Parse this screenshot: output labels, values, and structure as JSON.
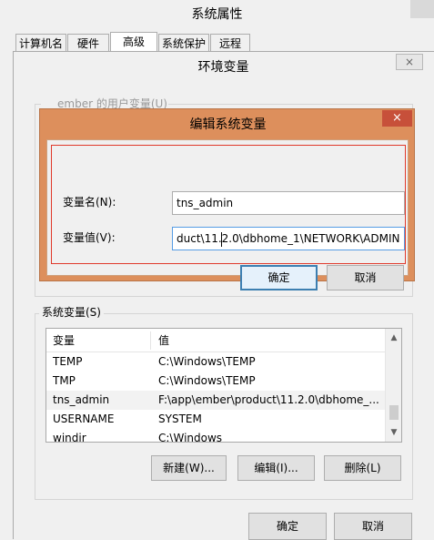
{
  "system_properties": {
    "title": "系统属性",
    "tabs": [
      {
        "label": "计算机名"
      },
      {
        "label": "硬件"
      },
      {
        "label": "高级"
      },
      {
        "label": "系统保护"
      },
      {
        "label": "远程"
      }
    ]
  },
  "env_window": {
    "title": "环境变量",
    "close_label": "×",
    "user_vars_label": "ember 的用户变量(U)",
    "system_vars_label": "系统变量(S)",
    "columns": [
      "变量",
      "值"
    ],
    "rows": [
      {
        "name": "TEMP",
        "value": "C:\\Windows\\TEMP"
      },
      {
        "name": "TMP",
        "value": "C:\\Windows\\TEMP"
      },
      {
        "name": "tns_admin",
        "value": "F:\\app\\ember\\product\\11.2.0\\dbhome_..."
      },
      {
        "name": "USERNAME",
        "value": "SYSTEM"
      },
      {
        "name": "windir",
        "value": "C:\\Windows"
      }
    ],
    "selected_row": 2,
    "buttons": {
      "new": "新建(W)...",
      "edit": "编辑(I)...",
      "delete": "删除(L)"
    },
    "ok": "确定",
    "cancel": "取消"
  },
  "edit_dialog": {
    "title": "编辑系统变量",
    "close_label": "×",
    "name_label": "变量名(N):",
    "value_label": "变量值(V):",
    "name_value": "tns_admin",
    "value_value": "duct\\11.2.0\\dbhome_1\\NETWORK\\ADMIN",
    "ok": "确定",
    "cancel": "取消"
  },
  "colors": {
    "dialog_frame": "#dd8f5c",
    "close_button": "#c7503a",
    "focus_border": "#e0392b",
    "default_button": "#3c7fb1"
  },
  "icons": {
    "scroll_up": "▲",
    "scroll_down": "▼"
  }
}
